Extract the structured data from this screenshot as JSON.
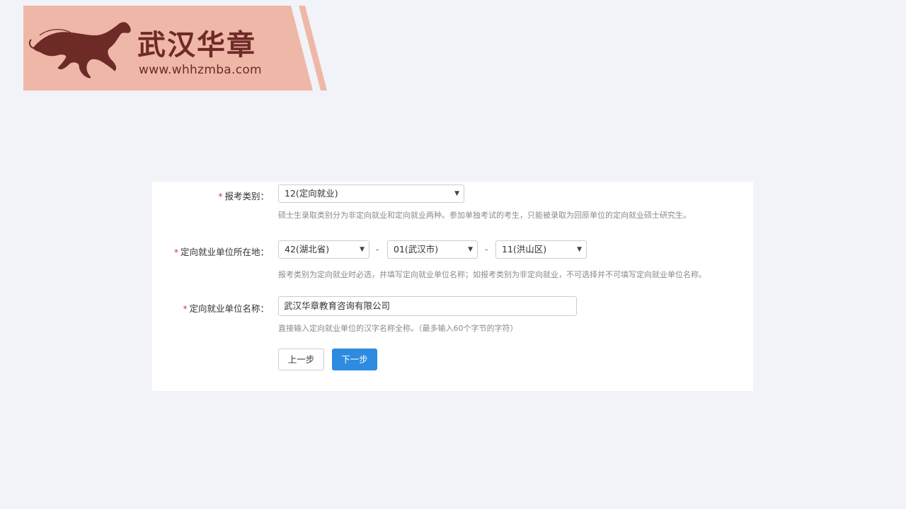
{
  "brand": {
    "name": "武汉华章",
    "url": "www.whhzmba.com",
    "banner_color": "#efb7a7",
    "text_color": "#6e2a26",
    "logo_icon": "horse-icon"
  },
  "form": {
    "exam_category": {
      "label": "报考类别：",
      "selected": "12(定向就业)",
      "hint": "硕士生录取类别分为非定向就业和定向就业两种。参加单独考试的考生，只能被录取为回原单位的定向就业硕士研究生。"
    },
    "employer_location": {
      "label": "定向就业单位所在地：",
      "province": "42(湖北省)",
      "city": "01(武汉市)",
      "district": "11(洪山区)",
      "separator": "-",
      "hint": "报考类别为定向就业时必选，并填写定向就业单位名称；如报考类别为非定向就业，不可选择并不可填写定向就业单位名称。"
    },
    "employer_name": {
      "label": "定向就业单位名称：",
      "value": "武汉华章教育咨询有限公司",
      "hint": "直接输入定向就业单位的汉字名称全称。（最多输入60个字节的字符）"
    },
    "required_mark": "*",
    "buttons": {
      "prev": "上一步",
      "next": "下一步"
    },
    "accent_color": "#2d8ce0"
  }
}
